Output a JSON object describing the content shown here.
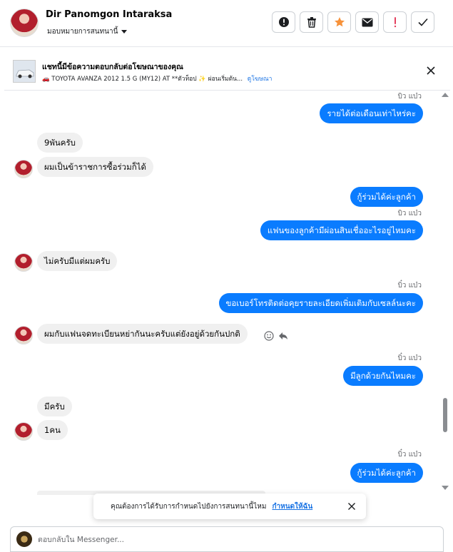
{
  "header": {
    "contact_name": "Dir Panomgon Intaraksa",
    "assign_label": "มอบหมายการสนทนานี้"
  },
  "toolbar": {
    "buttons": [
      {
        "icon": "alert-circle-icon"
      },
      {
        "icon": "trash-icon"
      },
      {
        "icon": "star-icon",
        "color": "#f7923a"
      },
      {
        "icon": "envelope-icon"
      },
      {
        "icon": "exclamation-icon",
        "color": "#e4405f"
      },
      {
        "icon": "checkmark-icon"
      }
    ]
  },
  "ad": {
    "title": "แชทนี้มีข้อความตอบกลับต่อโฆษณาของคุณ",
    "subtitle": "🚗 TOYOTA AVANZA 2012 1.5 G (MY12) AT **ตัวท็อป ✨ ผ่อนเริ่มต้น...",
    "link": "ดูโฆษณา"
  },
  "messages": [
    {
      "dir": "out",
      "text": "รายได้ต่อเดือนเท่าไหร่คะ",
      "sender": "บิว แบ๋ว"
    },
    {
      "dir": "in",
      "text": "9พันครับ"
    },
    {
      "dir": "in",
      "text": "ผมเป็นข้าราชการซื้อร่วมก็ได้"
    },
    {
      "dir": "out",
      "text": "กู้ร่วมได้ค่ะลูกค้า"
    },
    {
      "dir": "out",
      "text": "แฟนของลูกค้ามีผ่อนสินเชื่ออะไรอยู่ไหมคะ",
      "sender": "บิว แบ๋ว"
    },
    {
      "dir": "in",
      "text": "ไม่ครับมีแต่ผมครับ"
    },
    {
      "dir": "out",
      "text": "ขอเบอร์โทรติดต่อคุยรายละเอียดเพิ่มเติมกับเซลล์นะคะ",
      "sender": "บิ๋ว แบ๋ว"
    },
    {
      "dir": "in",
      "text": "ผมกับแฟนจดทะเบียนหย่ากันนะครับแต่ยังอยู่ด้วยกันปกติ"
    },
    {
      "dir": "out",
      "text": "มีลูกด้วยกันไหมคะ",
      "sender": "บิ๋ว แบ๋ว"
    },
    {
      "dir": "in",
      "text": "มีครับ"
    },
    {
      "dir": "in",
      "text": "1คน"
    },
    {
      "dir": "out",
      "text": "กู้ร่วมได้ค่ะลูกค้า",
      "sender": "บิ๋ว แบ๋ว"
    }
  ],
  "toast": {
    "text": "คุณต้องการได้รับการกำหนดไปยังการสนทนานี้ไหม",
    "link": "กำหนดให้ฉัน"
  },
  "composer": {
    "placeholder": "ตอบกลับใน Messenger..."
  },
  "colors": {
    "outgoing_bubble": "#0a7cff",
    "incoming_bubble": "#f0f0f0",
    "link": "#1b74e4"
  }
}
